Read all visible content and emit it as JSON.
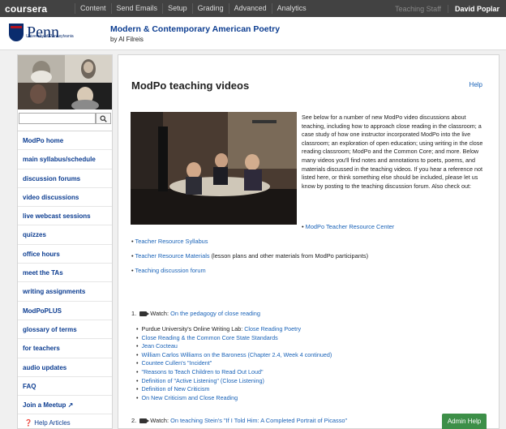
{
  "topbar": {
    "logo": "coursera",
    "nav": [
      "Content",
      "Send Emails",
      "Setup",
      "Grading",
      "Advanced",
      "Analytics"
    ],
    "staff_label": "Teaching Staff",
    "user_name": "David Poplar"
  },
  "header": {
    "logo_text": "Penn",
    "logo_sub": "University of Pennsylvania",
    "course_title": "Modern & Contemporary American Poetry",
    "author": "by Al Filreis"
  },
  "sidebar": {
    "search_placeholder": "",
    "menu": [
      "ModPo home",
      "main syllabus/schedule",
      "discussion forums",
      "video discussions",
      "live webcast sessions",
      "quizzes",
      "office hours",
      "meet the TAs",
      "writing assignments",
      "ModPoPLUS",
      "glossary of terms",
      "for teachers",
      "audio updates",
      "FAQ",
      "Join a Meetup"
    ],
    "help_articles": "Help Articles"
  },
  "main": {
    "title": "ModPo teaching videos",
    "help": "Help",
    "intro": "See below for a number of new ModPo video discussions about teaching, including how to approach close reading in the classroom; a case study of how one instructor incorporated ModPo into the live classroom; an exploration of open education; using writing in the close reading classroom; ModPo and the Common Core; and more. Below many videos you'll find notes and annotations to poets, poems, and materials discussed in the teaching videos. If you hear a reference not listed here, or think something else should be included, please let us know by posting to the teaching discussion forum. Also check out:",
    "resource_center": "ModPo Teacher Resource Center",
    "syllabus": "Teacher Resource Syllabus",
    "materials_link": "Teacher Resource Materials",
    "materials_note": "(lesson plans and other materials from ModPo participants)",
    "forum": "Teaching discussion forum",
    "watch1_num": "1.",
    "watch_label": "Watch:",
    "watch1_link": "On the pedagogy of close reading",
    "sub_items": [
      {
        "prefix": "Purdue University's Online Writing Lab: ",
        "link": "Close Reading Poetry"
      },
      {
        "prefix": "",
        "link": "Close Reading & the Common Core State Standards"
      },
      {
        "prefix": "",
        "link": "Jean Cocteau"
      },
      {
        "prefix": "",
        "link": "William Carlos Williams on the Baroness (Chapter 2.4, Week 4 continued)"
      },
      {
        "prefix": "",
        "link": "Countee Cullen's \"Incident\""
      },
      {
        "prefix": "",
        "link": "\"Reasons to Teach Children to Read Out Loud\""
      },
      {
        "prefix": "",
        "link": "Definition of \"Active Listening\" (Close Listening)"
      },
      {
        "prefix": "",
        "link": "Definition of New Criticism"
      },
      {
        "prefix": "",
        "link": "On New Criticism and Close Reading"
      }
    ],
    "watch2_num": "2.",
    "watch2_link": "On teaching Stein's \"If I Told Him: A Completed Portrait of Picasso\""
  },
  "admin_help": "Admin Help"
}
